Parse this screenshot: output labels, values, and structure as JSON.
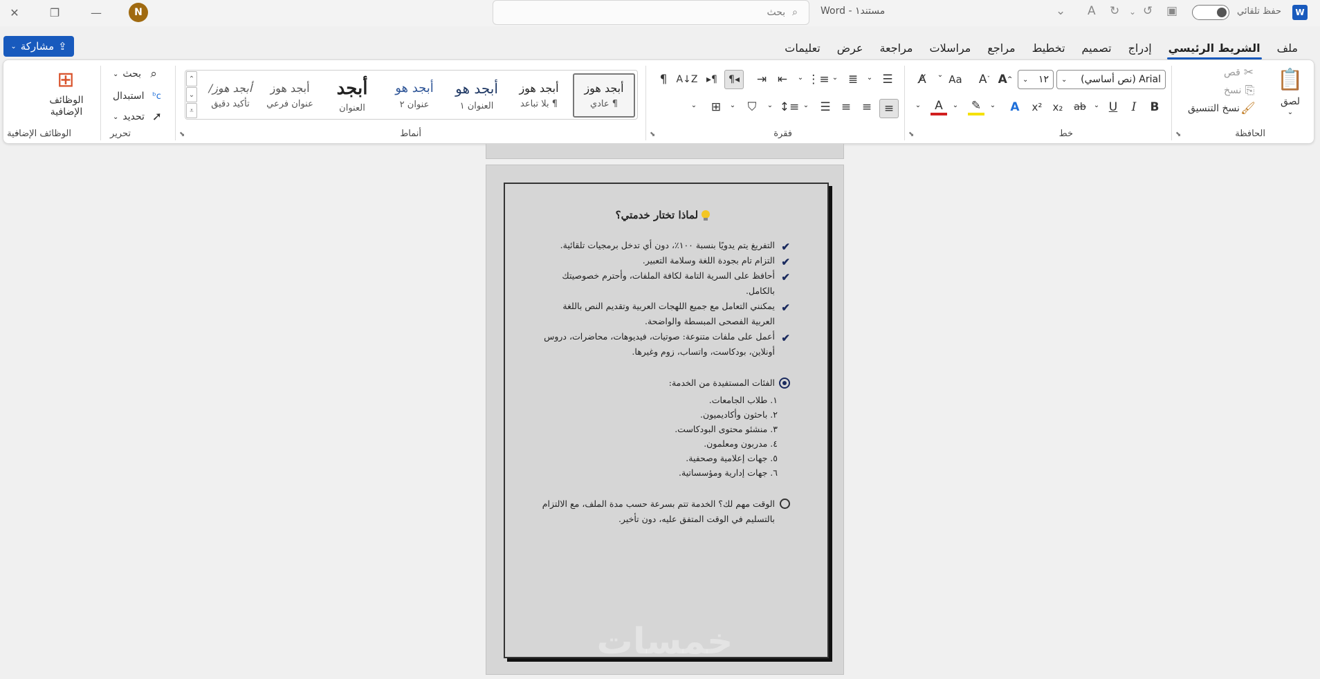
{
  "titlebar": {
    "app_name": "Word",
    "doc_name": "مستند١",
    "separator": "-",
    "search_placeholder": "بحث",
    "autosave_label": "حفظ تلقائي",
    "avatar_initial": "N",
    "word_icon_letter": "W"
  },
  "tabs": [
    {
      "label": "ملف"
    },
    {
      "label": "الشريط الرئيسي"
    },
    {
      "label": "إدراج"
    },
    {
      "label": "تصميم"
    },
    {
      "label": "تخطيط"
    },
    {
      "label": "مراجع"
    },
    {
      "label": "مراسلات"
    },
    {
      "label": "مراجعة"
    },
    {
      "label": "عرض"
    },
    {
      "label": "تعليمات"
    }
  ],
  "share_label": "مشاركة",
  "ribbon": {
    "clipboard": {
      "label": "الحافظة",
      "paste": "لصق",
      "cut": "قص",
      "copy": "نسخ",
      "format_painter": "نسخ التنسيق"
    },
    "font": {
      "label": "خط",
      "font_name": "Arial (نص أساسي)",
      "font_size": "١٢"
    },
    "paragraph": {
      "label": "فقرة"
    },
    "styles": {
      "label": "أنماط",
      "items": [
        {
          "preview": "أبجد هوز",
          "name": "¶ عادي"
        },
        {
          "preview": "أبجد هوز",
          "name": "¶ بلا تباعد"
        },
        {
          "preview": "أبجد هو",
          "name": "العنوان ١"
        },
        {
          "preview": "أبجد هو",
          "name": "عنوان ٢"
        },
        {
          "preview": "أبجد",
          "name": "العنوان"
        },
        {
          "preview": "أبجد هوز",
          "name": "عنوان فرعي"
        },
        {
          "preview": "أبجد هوز/",
          "name": "تأكيد دقيق"
        }
      ]
    },
    "editing": {
      "label": "تحرير",
      "find": "بحث",
      "replace": "استبدال",
      "select": "تحديد"
    },
    "addins": {
      "label": "الوظائف الإضافية",
      "button": "الوظائف الإضافية"
    }
  },
  "document": {
    "heading": "لماذا تختار خدمتي؟",
    "bullets": [
      "التفريغ يتم يدويًا بنسبة ١٠٠٪، دون أي تدخل برمجيات تلقائية.",
      "التزام تام بجودة اللغة وسلامة التعبير.",
      "أحافظ على السرية التامة لكافة الملفات، وأحترم خصوصيتك بالكامل.",
      "يمكنني التعامل مع جميع اللهجات العربية وتقديم النص باللغة العربية الفصحى المبسطة والواضحة.",
      "أعمل على ملفات متنوعة: صوتيات، فيديوهات، محاضرات، دروس أونلاين، بودكاست، واتساب، زوم وغيرها."
    ],
    "audience_title": "الفئات المستفيدة من الخدمة:",
    "audience": [
      "١. طلاب الجامعات.",
      "٢. باحثون وأكاديميون.",
      "٣. منشئو محتوى البودكاست.",
      "٤. مدربون ومعلمون.",
      "٥. جهات إعلامية وصحفية.",
      "٦. جهات إدارية ومؤسساتية."
    ],
    "time_note": "الوقت مهم لك؟ الخدمة تتم بسرعة حسب مدة الملف، مع الالتزام بالتسليم في الوقت المتفق عليه، دون تأخير.",
    "watermark": "خمسات"
  },
  "colors": {
    "accent": "#185abd",
    "check": "#1a2a5e",
    "avatar": "#a06a10"
  }
}
